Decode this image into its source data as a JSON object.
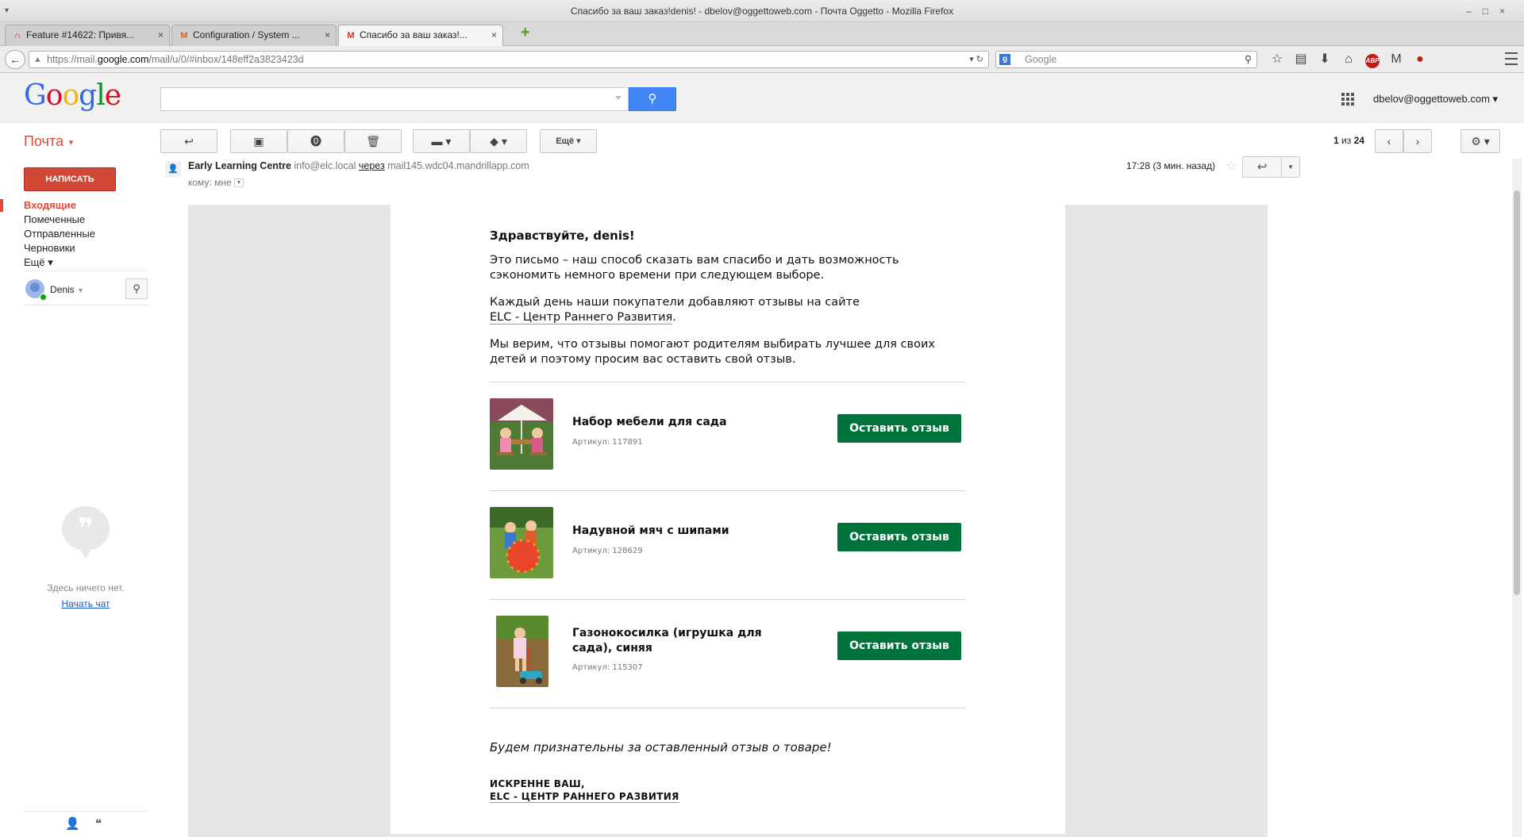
{
  "browser": {
    "window_title": "Спасибо за ваш заказ!denis! - dbelov@oggettoweb.com - Почта Oggetto - Mozilla Firefox",
    "tabs": [
      {
        "label": "Feature #14622: Привя...",
        "icon": "redmine-icon"
      },
      {
        "label": "Configuration / System ...",
        "icon": "magento-icon"
      },
      {
        "label": "Спасибо за ваш заказ!...",
        "icon": "gmail-icon"
      }
    ],
    "url_prefix": "https://mail.",
    "url_domain": "google.com",
    "url_path": "/mail/u/0/#inbox/148eff2a3823423d",
    "search_placeholder": "Google",
    "close_glyph": "×",
    "newtab_glyph": "+"
  },
  "gmail": {
    "logo": {
      "G": "G",
      "o1": "o",
      "o2": "o",
      "g": "g",
      "l": "l",
      "e": "e"
    },
    "account": "dbelov@oggettoweb.com",
    "mail_label": "Почта",
    "more_label": "Ещё",
    "pager_current": "1",
    "pager_sep": "из",
    "pager_total": "24",
    "compose": "НАПИСАТЬ",
    "nav": [
      "Входящие",
      "Помеченные",
      "Отправленные",
      "Черновики",
      "Ещё"
    ],
    "chat_user": "Denis",
    "chat_empty": "Здесь ничего нет.",
    "chat_start": "Начать чат"
  },
  "message": {
    "sender_name": "Early Learning Centre",
    "sender_email": "info@elc.local",
    "via_label": "через",
    "via_domain": "mail145.wdc04.mandrillapp.com",
    "to_label": "кому: мне",
    "time": "17:28 (3 мин. назад)"
  },
  "email": {
    "greeting": "Здравствуйте, denis!",
    "p1": "Это письмо – наш способ сказать вам спасибо и дать возможность сэкономить немного времени при следующем выборе.",
    "p2_text": "Каждый день наши покупатели добавляют отзывы на сайте",
    "p2_link": "ELC - Центр Раннего Развития",
    "p2_end": ".",
    "p3": "Мы верим, что отзывы помогают родителям выбирать лучшее для своих детей и поэтому просим вас оставить свой отзыв.",
    "products": [
      {
        "name": "Набор мебели для сада",
        "sku": "Артикул: 117891",
        "button": "Оставить отзыв"
      },
      {
        "name": "Надувной мяч с шипами",
        "sku": "Артикул: 128629",
        "button": "Оставить отзыв"
      },
      {
        "name": "Газонокосилка (игрушка для сада), синяя",
        "sku": "Артикул: 115307",
        "button": "Оставить отзыв"
      }
    ],
    "thanks": "Будем признательны за оставленный отзыв о товаре!",
    "sign1": "ИСКРЕННЕ ВАШ,",
    "sign2": "ELC - ЦЕНТР РАННЕГО РАЗВИТИЯ"
  },
  "colors": {
    "compose_red": "#d14836",
    "gmail_red": "#dd4b39",
    "search_blue": "#4285f4",
    "review_green": "#00733c",
    "link_blue": "#1155cc"
  }
}
